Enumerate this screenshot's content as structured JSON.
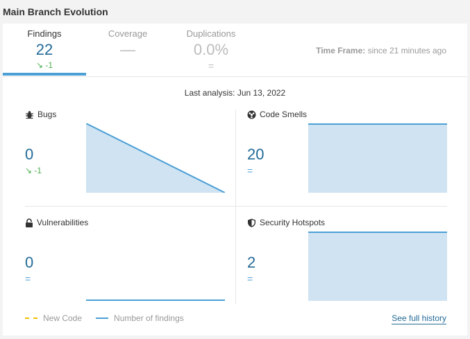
{
  "header": {
    "title": "Main Branch Evolution"
  },
  "tabs": [
    {
      "label": "Findings",
      "value": "22",
      "delta": "-1",
      "delta_icon": "arrow-down-right-icon"
    },
    {
      "label": "Coverage",
      "value": "—"
    },
    {
      "label": "Duplications",
      "value": "0.0%",
      "delta": "="
    }
  ],
  "timeframe": {
    "label": "Time Frame:",
    "value": "since 21 minutes ago"
  },
  "last_analysis": "Last analysis: Jun 13, 2022",
  "panels": {
    "bugs": {
      "title": "Bugs",
      "icon": "bug-icon",
      "value": "0",
      "delta": "-1",
      "delta_icon": "arrow-down-right-icon"
    },
    "code_smells": {
      "title": "Code Smells",
      "icon": "code-smell-icon",
      "value": "20",
      "delta": "="
    },
    "vulnerabilities": {
      "title": "Vulnerabilities",
      "icon": "lock-icon",
      "value": "0",
      "delta": "="
    },
    "security_hotspots": {
      "title": "Security Hotspots",
      "icon": "shield-icon",
      "value": "2",
      "delta": "="
    }
  },
  "chart_data": [
    {
      "type": "area",
      "panel": "Bugs",
      "values": [
        1,
        0
      ]
    },
    {
      "type": "area",
      "panel": "Code Smells",
      "values": [
        20,
        20
      ]
    },
    {
      "type": "area",
      "panel": "Vulnerabilities",
      "values": [
        0,
        0
      ]
    },
    {
      "type": "area",
      "panel": "Security Hotspots",
      "values": [
        2,
        2
      ]
    }
  ],
  "legend": {
    "new_code": "New Code",
    "number_of_findings": "Number of findings"
  },
  "links": {
    "full_history": "See full history"
  },
  "colors": {
    "accent": "#4b9fd5",
    "value_blue": "#236a97",
    "area_fill": "#cfe3f2",
    "improve_green": "#4caf50",
    "new_code_yellow": "#f0c000"
  }
}
